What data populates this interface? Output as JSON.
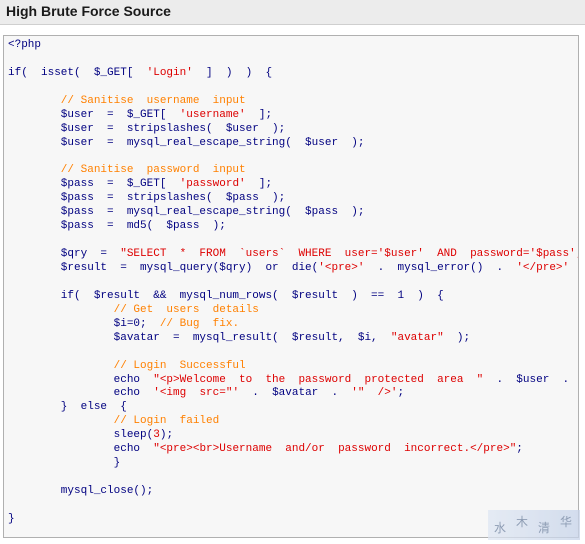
{
  "window": {
    "title": "High Brute Force Source"
  },
  "code_lines": [
    [
      {
        "t": "<?php",
        "c": "php"
      }
    ],
    [],
    [
      {
        "t": "if(  isset(  $_GET[  ",
        "c": "kw"
      },
      {
        "t": "'Login'",
        "c": "str"
      },
      {
        "t": "  ]  )  )  {",
        "c": "kw"
      }
    ],
    [],
    [
      {
        "t": "        // Sanitise  username  input",
        "c": "cmt"
      }
    ],
    [
      {
        "t": "        $user  =  $_GET[  ",
        "c": "var"
      },
      {
        "t": "'username'",
        "c": "str"
      },
      {
        "t": "  ];",
        "c": "var"
      }
    ],
    [
      {
        "t": "        $user  =  stripslashes(  $user  );",
        "c": "var"
      }
    ],
    [
      {
        "t": "        $user  =  mysql_real_escape_string(  $user  );",
        "c": "var"
      }
    ],
    [],
    [
      {
        "t": "        // Sanitise  password  input",
        "c": "cmt"
      }
    ],
    [
      {
        "t": "        $pass  =  $_GET[  ",
        "c": "var"
      },
      {
        "t": "'password'",
        "c": "str"
      },
      {
        "t": "  ];",
        "c": "var"
      }
    ],
    [
      {
        "t": "        $pass  =  stripslashes(  $pass  );",
        "c": "var"
      }
    ],
    [
      {
        "t": "        $pass  =  mysql_real_escape_string(  $pass  );",
        "c": "var"
      }
    ],
    [
      {
        "t": "        $pass  =  md5(  $pass  );",
        "c": "var"
      }
    ],
    [],
    [
      {
        "t": "        $qry  =  ",
        "c": "var"
      },
      {
        "t": "\"SELECT  *  FROM  `users`  WHERE  user='$user'  AND  password='$pass';\"",
        "c": "str"
      },
      {
        "t": ";",
        "c": "var"
      }
    ],
    [
      {
        "t": "        $result  =  mysql_query($qry)  or  die(",
        "c": "var"
      },
      {
        "t": "'<pre>'",
        "c": "str"
      },
      {
        "t": "  .  mysql_error()  .  ",
        "c": "var"
      },
      {
        "t": "'</pre>'",
        "c": "str"
      },
      {
        "t": "  );",
        "c": "var"
      }
    ],
    [],
    [
      {
        "t": "        if(  $result  &&  mysql_num_rows(  $result  )  ==  1  )  {",
        "c": "kw"
      }
    ],
    [
      {
        "t": "                // Get  users  details",
        "c": "cmt"
      }
    ],
    [
      {
        "t": "                $i=0;  ",
        "c": "var"
      },
      {
        "t": "// Bug  fix.",
        "c": "cmt"
      }
    ],
    [
      {
        "t": "                $avatar  =  mysql_result(  $result,  $i,  ",
        "c": "var"
      },
      {
        "t": "\"avatar\"",
        "c": "str"
      },
      {
        "t": "  );",
        "c": "var"
      }
    ],
    [],
    [
      {
        "t": "                // Login  Successful",
        "c": "cmt"
      }
    ],
    [
      {
        "t": "                echo  ",
        "c": "kw"
      },
      {
        "t": "\"<p>Welcome  to  the  password  protected  area  \"",
        "c": "str"
      },
      {
        "t": "  .  $user  .  ",
        "c": "var"
      },
      {
        "t": "\"</p>\"",
        "c": "str"
      },
      {
        "t": ";",
        "c": "var"
      }
    ],
    [
      {
        "t": "                echo  ",
        "c": "kw"
      },
      {
        "t": "'<img  src=\"'",
        "c": "str"
      },
      {
        "t": "  .  $avatar  .  ",
        "c": "var"
      },
      {
        "t": "'\"  />'",
        "c": "str"
      },
      {
        "t": ";",
        "c": "var"
      }
    ],
    [
      {
        "t": "        }  else  {",
        "c": "kw"
      }
    ],
    [
      {
        "t": "                // Login  failed",
        "c": "cmt"
      }
    ],
    [
      {
        "t": "                sleep(",
        "c": "kw"
      },
      {
        "t": "3",
        "c": "str"
      },
      {
        "t": ");",
        "c": "kw"
      }
    ],
    [
      {
        "t": "                echo  ",
        "c": "kw"
      },
      {
        "t": "\"<pre><br>Username  and/or  password  incorrect.</pre>\"",
        "c": "str"
      },
      {
        "t": ";",
        "c": "var"
      }
    ],
    [
      {
        "t": "                }",
        "c": "kw"
      }
    ],
    [],
    [
      {
        "t": "        mysql_close();",
        "c": "kw"
      }
    ],
    [],
    [
      {
        "t": "}",
        "c": "kw"
      }
    ],
    [],
    [
      {
        "t": "?>",
        "c": "php"
      }
    ]
  ],
  "watermark": {
    "chars": [
      "水",
      "木",
      "清",
      "华"
    ]
  }
}
